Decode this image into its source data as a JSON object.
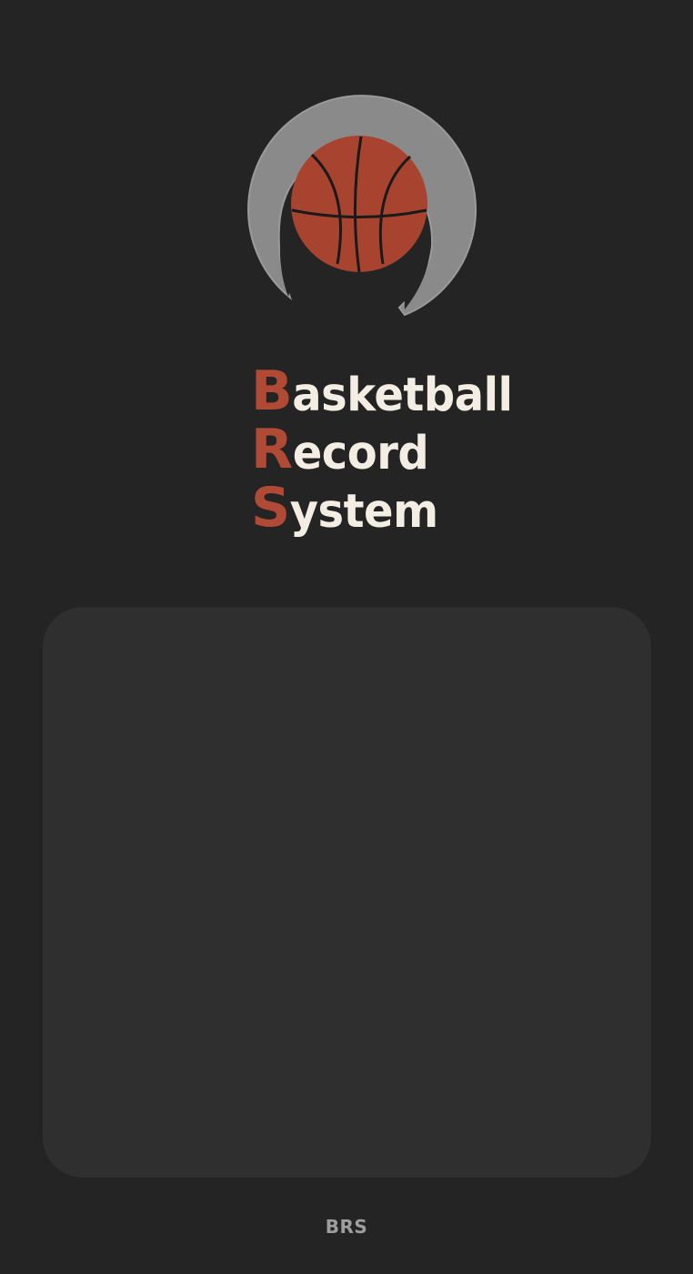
{
  "app": {
    "logo_icon": "basketball-hoop-icon"
  },
  "title": {
    "lines": [
      {
        "initial": "B",
        "rest": "asketball"
      },
      {
        "initial": "R",
        "rest": "ecord"
      },
      {
        "initial": "S",
        "rest": "ystem"
      }
    ]
  },
  "footer": {
    "label": "BRS"
  },
  "colors": {
    "background": "#242424",
    "card": "#2f2f2f",
    "accent": "#b04a35",
    "title_text": "#f3ede3",
    "footer_text": "#9e9e9e",
    "logo_ring": "#8a8a8a"
  }
}
